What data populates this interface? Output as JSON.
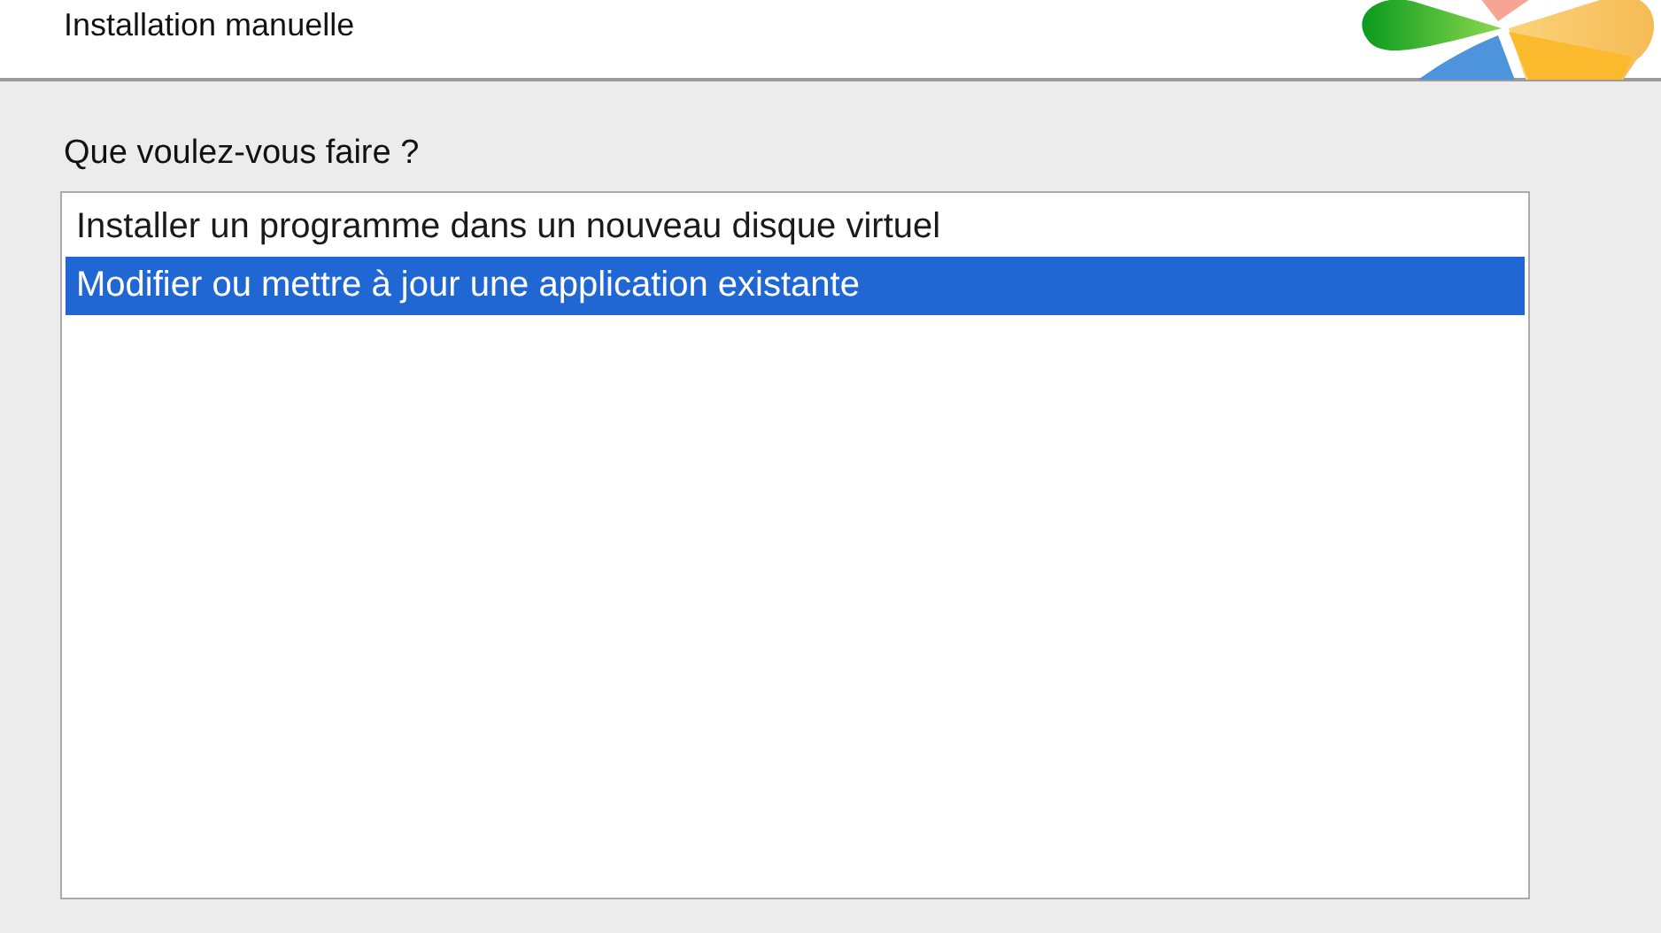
{
  "header": {
    "title": "Installation manuelle"
  },
  "prompt": "Que voulez-vous faire ?",
  "options": [
    {
      "label": "Installer un programme dans un nouveau disque virtuel",
      "selected": false
    },
    {
      "label": "Modifier ou mettre à jour une application existante",
      "selected": true
    }
  ]
}
